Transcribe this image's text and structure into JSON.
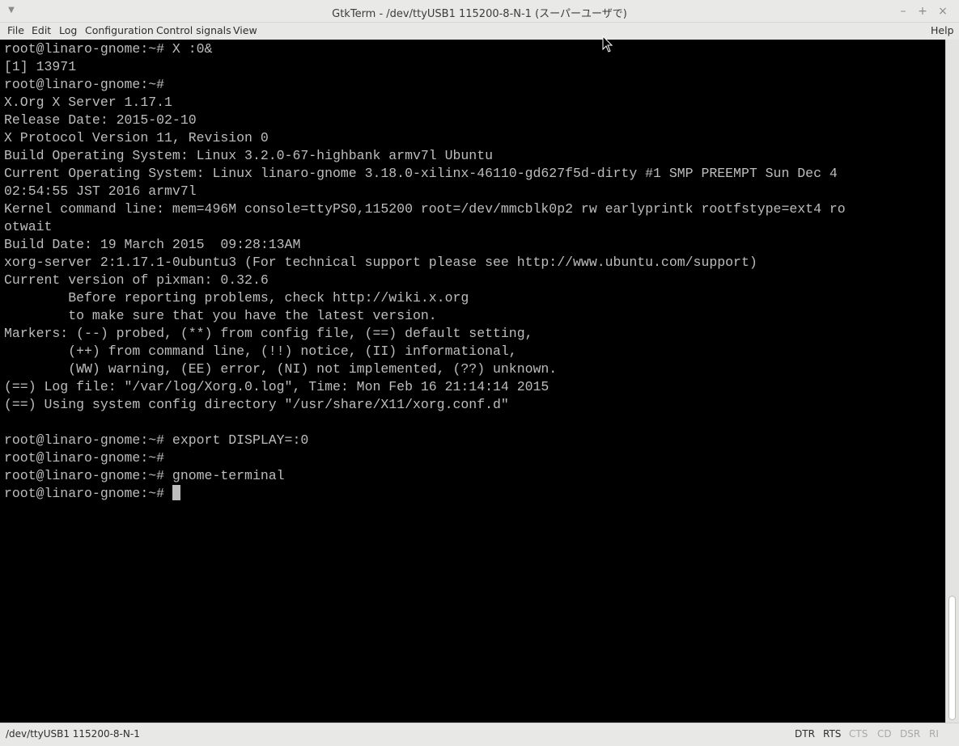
{
  "window": {
    "title": "GtkTerm - /dev/ttyUSB1  115200-8-N-1 (スーパーユーザで)",
    "menu_icon": "chevron-down-icon",
    "minimize": "–",
    "maximize": "+",
    "close": "×"
  },
  "menubar": {
    "file": "File",
    "edit": "Edit",
    "log": "Log",
    "configuration": "Configuration",
    "control_signals": "Control signals",
    "view": "View",
    "help": "Help"
  },
  "terminal": {
    "lines": [
      "root@linaro-gnome:~# X :0&",
      "[1] 13971",
      "root@linaro-gnome:~#",
      "X.Org X Server 1.17.1",
      "Release Date: 2015-02-10",
      "X Protocol Version 11, Revision 0",
      "Build Operating System: Linux 3.2.0-67-highbank armv7l Ubuntu",
      "Current Operating System: Linux linaro-gnome 3.18.0-xilinx-46110-gd627f5d-dirty #1 SMP PREEMPT Sun Dec 4",
      "02:54:55 JST 2016 armv7l",
      "Kernel command line: mem=496M console=ttyPS0,115200 root=/dev/mmcblk0p2 rw earlyprintk rootfstype=ext4 ro",
      "otwait",
      "Build Date: 19 March 2015  09:28:13AM",
      "xorg-server 2:1.17.1-0ubuntu3 (For technical support please see http://www.ubuntu.com/support)",
      "Current version of pixman: 0.32.6",
      "        Before reporting problems, check http://wiki.x.org",
      "        to make sure that you have the latest version.",
      "Markers: (--) probed, (**) from config file, (==) default setting,",
      "        (++) from command line, (!!) notice, (II) informational,",
      "        (WW) warning, (EE) error, (NI) not implemented, (??) unknown.",
      "(==) Log file: \"/var/log/Xorg.0.log\", Time: Mon Feb 16 21:14:14 2015",
      "(==) Using system config directory \"/usr/share/X11/xorg.conf.d\"",
      "",
      "root@linaro-gnome:~# export DISPLAY=:0",
      "root@linaro-gnome:~#",
      "root@linaro-gnome:~# gnome-terminal"
    ],
    "prompt": "root@linaro-gnome:~# "
  },
  "status": {
    "port": "/dev/ttyUSB1  115200-8-N-1",
    "signals": {
      "dtr": "DTR",
      "rts": "RTS",
      "cts": "CTS",
      "cd": "CD",
      "dsr": "DSR",
      "ri": "RI"
    }
  }
}
